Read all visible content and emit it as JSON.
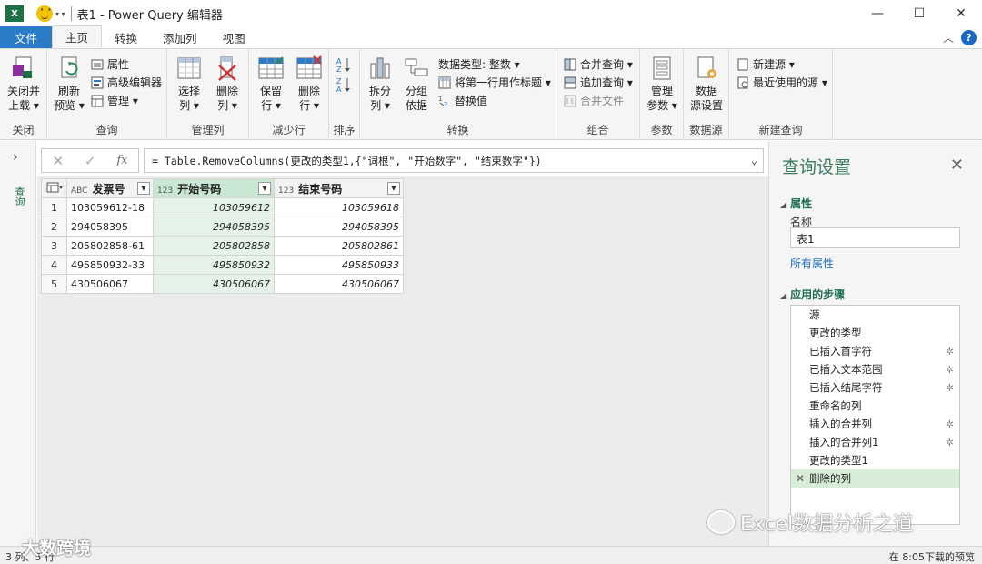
{
  "titlebar": {
    "title": "表1 - Power Query 编辑器",
    "app_icon": "excel-icon",
    "minimize": "—",
    "maximize": "☐",
    "close": "✕"
  },
  "tabs": [
    "文件",
    "主页",
    "转换",
    "添加列",
    "视图"
  ],
  "active_tab": "主页",
  "ribbon": {
    "close": {
      "label": "关闭",
      "close_load_1": "关闭并",
      "close_load_2": "上载 ▾"
    },
    "query": {
      "label": "查询",
      "refresh_1": "刷新",
      "refresh_2": "预览 ▾",
      "properties": "属性",
      "advanced_editor": "高级编辑器",
      "manage": "管理 ▾"
    },
    "manage_columns": {
      "label": "管理列",
      "choose_1": "选择",
      "choose_2": "列 ▾",
      "remove_1": "删除",
      "remove_2": "列 ▾"
    },
    "reduce_rows": {
      "label": "减少行",
      "keep_1": "保留",
      "keep_2": "行 ▾",
      "remove_1": "删除",
      "remove_2": "行 ▾"
    },
    "sort": {
      "label": "排序"
    },
    "transform": {
      "label": "转换",
      "split_1": "拆分",
      "split_2": "列 ▾",
      "group_1": "分组",
      "group_2": "依据",
      "data_type": "数据类型: 整数 ▾",
      "first_row_header": "将第一行用作标题 ▾",
      "replace_values": "替换值"
    },
    "combine": {
      "label": "组合",
      "merge": "合并查询 ▾",
      "append": "追加查询 ▾",
      "merge_files": "合并文件"
    },
    "parameters": {
      "label": "参数",
      "manage_1": "管理",
      "manage_2": "参数 ▾"
    },
    "data_source": {
      "label": "数据源",
      "settings_1": "数据",
      "settings_2": "源设置"
    },
    "new_query": {
      "label": "新建查询",
      "new_source": "新建源 ▾",
      "recent_sources": "最近使用的源 ▾"
    }
  },
  "leftnav": {
    "label": "查询"
  },
  "formula": {
    "cancel": "✕",
    "confirm": "✓",
    "fx": "fx",
    "text": "= Table.RemoveColumns(更改的类型1,{\"词根\", \"开始数字\", \"结束数字\"})"
  },
  "grid": {
    "columns": [
      {
        "type": "ABC",
        "name": "发票号"
      },
      {
        "type": "123",
        "name": "开始号码"
      },
      {
        "type": "123",
        "name": "结束号码"
      }
    ],
    "rows": [
      {
        "n": "1",
        "a": "103059612-18",
        "b": "103059612",
        "c": "103059618"
      },
      {
        "n": "2",
        "a": "294058395",
        "b": "294058395",
        "c": "294058395"
      },
      {
        "n": "3",
        "a": "205802858-61",
        "b": "205802858",
        "c": "205802861"
      },
      {
        "n": "4",
        "a": "495850932-33",
        "b": "495850932",
        "c": "495850933"
      },
      {
        "n": "5",
        "a": "430506067",
        "b": "430506067",
        "c": "430506067"
      }
    ]
  },
  "settings": {
    "title": "查询设置",
    "properties_header": "属性",
    "name_label": "名称",
    "name_value": "表1",
    "all_properties": "所有属性",
    "steps_header": "应用的步骤",
    "steps": [
      {
        "label": "源",
        "gear": false
      },
      {
        "label": "更改的类型",
        "gear": false
      },
      {
        "label": "已插入首字符",
        "gear": true
      },
      {
        "label": "已插入文本范围",
        "gear": true
      },
      {
        "label": "已插入结尾字符",
        "gear": true
      },
      {
        "label": "重命名的列",
        "gear": false
      },
      {
        "label": "插入的合并列",
        "gear": true
      },
      {
        "label": "插入的合并列1",
        "gear": true
      },
      {
        "label": "更改的类型1",
        "gear": false
      },
      {
        "label": "删除的列",
        "gear": false,
        "active": true
      }
    ]
  },
  "status": {
    "left": "3 列、5 行",
    "right": "在 8:05下载的预览"
  },
  "watermarks": {
    "wechat": "Excel数据分析之道",
    "site": "大数跨境"
  }
}
